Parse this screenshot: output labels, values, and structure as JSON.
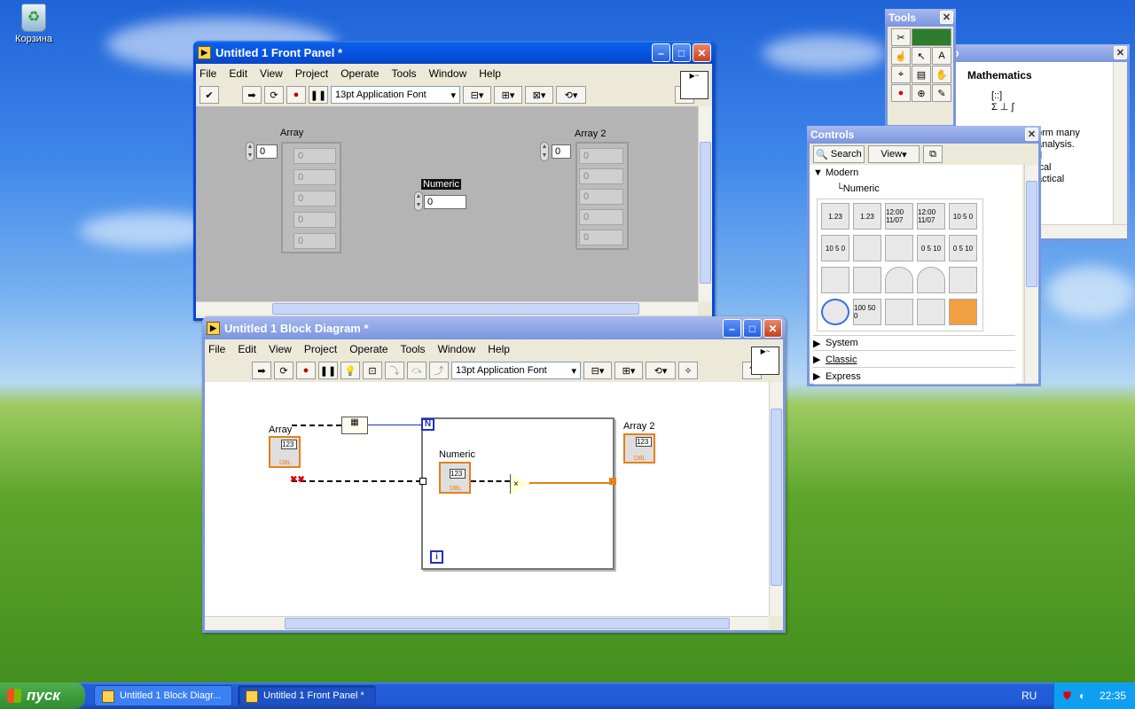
{
  "desktop": {
    "recycle_bin_label": "Корзина"
  },
  "front_panel": {
    "title": "Untitled 1 Front Panel *",
    "menu": [
      "File",
      "Edit",
      "View",
      "Project",
      "Operate",
      "Tools",
      "Window",
      "Help"
    ],
    "font_select": "13pt Application Font",
    "controls": {
      "array_label": "Array",
      "array_index": "0",
      "array_values": [
        "0",
        "0",
        "0",
        "0",
        "0"
      ],
      "numeric_label": "Numeric",
      "numeric_value": "0",
      "array2_label": "Array 2",
      "array2_index": "0",
      "array2_values": [
        "0",
        "0",
        "0",
        "0",
        "0"
      ]
    }
  },
  "block_diagram": {
    "title": "Untitled 1 Block Diagram *",
    "menu": [
      "File",
      "Edit",
      "View",
      "Project",
      "Operate",
      "Tools",
      "Window",
      "Help"
    ],
    "font_select": "13pt Application Font",
    "nodes": {
      "array_label": "Array",
      "array_type": "DBL",
      "array_icon": "123",
      "numeric_label": "Numeric",
      "numeric_type": "DBL",
      "numeric_icon": "123",
      "array2_label": "Array 2",
      "array2_type": "DBL",
      "array2_icon": "123",
      "loop_count": "N",
      "loop_index": "i",
      "multiply": "×"
    }
  },
  "tools_palette": {
    "title": "Tools"
  },
  "controls_palette": {
    "title": "Controls",
    "search_label": "Search",
    "view_label": "View",
    "tree": {
      "modern": "Modern",
      "numeric": "Numeric",
      "system": "System",
      "classic": "Classic",
      "express": "Express"
    },
    "icons": [
      "1.23",
      "1.23",
      "12:00 11/07",
      "12:00 11/07",
      "10 5 0",
      "10 5 0",
      "",
      "",
      "0 5 10",
      "0 5 10",
      "",
      "",
      "",
      "",
      "",
      "",
      "100 50 0",
      "",
      "",
      ""
    ]
  },
  "help_window": {
    "heading": "Mathematics",
    "lines": [
      "orm many",
      "analysis.",
      "d",
      "ical",
      "actical"
    ]
  },
  "taskbar": {
    "start_label": "пуск",
    "tasks": [
      "Untitled 1 Block Diagr...",
      "Untitled 1 Front Panel *"
    ],
    "language": "RU",
    "clock": "22:35"
  }
}
